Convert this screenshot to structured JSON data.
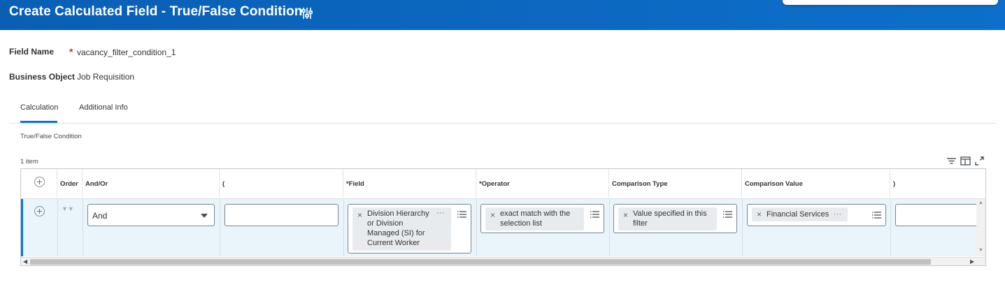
{
  "header": {
    "title": "Create Calculated Field - True/False Condition",
    "icon": "settings-sliders-icon",
    "background_color": "#0b6cc4"
  },
  "fields": {
    "field_name_label": "Field Name",
    "required_marker": "*",
    "field_name_value": "vacancy_filter_condition_1",
    "business_object_label": "Business Object",
    "business_object_value": "Job Requisition"
  },
  "tabs": [
    {
      "label": "Calculation",
      "active": true
    },
    {
      "label": "Additional Info",
      "active": false
    }
  ],
  "section": {
    "label": "True/False Condition"
  },
  "grid": {
    "item_count": "1 item",
    "toolbar_icons": [
      "filter-icon",
      "column-layout-icon",
      "expand-icon"
    ],
    "columns": [
      "Order",
      "And/Or",
      "(",
      "*Field",
      "*Operator",
      "Comparison Type",
      "Comparison Value",
      ")"
    ],
    "row": {
      "and_or": "And",
      "open_paren": "",
      "field": [
        "Division Hierarchy",
        "or Division",
        "Managed (SI) for",
        "Current Worker"
      ],
      "operator": [
        "exact match with the",
        "selection list"
      ],
      "comparison_type": [
        "Value specified in this",
        "filter"
      ],
      "comparison_value": "Financial Services",
      "close_paren": ""
    }
  },
  "colors": {
    "accent": "#0875e1",
    "row_highlight": "#e9f4fb",
    "required": "#de2e21"
  }
}
